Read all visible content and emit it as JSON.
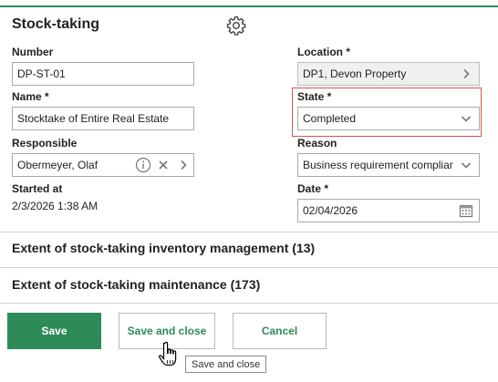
{
  "title": "Stock-taking",
  "fields": {
    "number": {
      "label": "Number",
      "value": "DP-ST-01"
    },
    "location": {
      "label": "Location *",
      "value": "DP1, Devon Property"
    },
    "name": {
      "label": "Name *",
      "value": "Stocktake of Entire Real Estate"
    },
    "state": {
      "label": "State *",
      "value": "Completed"
    },
    "responsible": {
      "label": "Responsible",
      "value": "Obermeyer, Olaf"
    },
    "reason": {
      "label": "Reason",
      "value": "Business requirement compliance"
    },
    "started_at": {
      "label": "Started at",
      "value": "2/3/2026 1:38 AM"
    },
    "date": {
      "label": "Date *",
      "value": "02/04/2026"
    }
  },
  "sections": {
    "inventory": "Extent of stock-taking inventory management (13)",
    "maintenance": "Extent of stock-taking maintenance (173)"
  },
  "buttons": {
    "save": "Save",
    "save_close": "Save and close",
    "cancel": "Cancel"
  },
  "tooltip": "Save and close",
  "colors": {
    "accent": "#2e8b57",
    "highlight": "#d9534f"
  }
}
